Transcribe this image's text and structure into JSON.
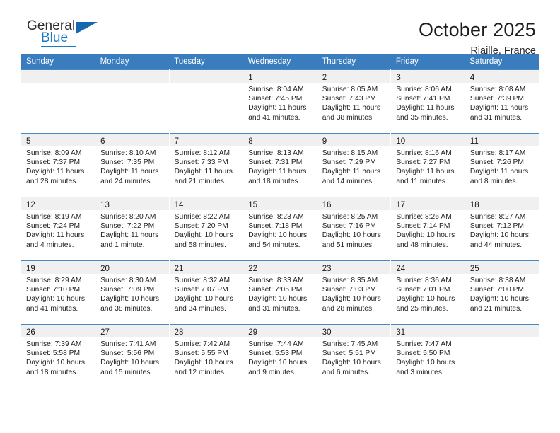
{
  "brand": {
    "name_top": "General",
    "name_bottom": "Blue",
    "accent_color": "#1b7ac4",
    "triangle_icon": "brand-triangle-icon"
  },
  "header": {
    "title": "October 2025",
    "subtitle": "Riaille, France"
  },
  "colors": {
    "header_row": "#3a7dbf",
    "row_divider": "#4a87c6",
    "daynum_band": "#f0f0f0"
  },
  "weekdays": [
    "Sunday",
    "Monday",
    "Tuesday",
    "Wednesday",
    "Thursday",
    "Friday",
    "Saturday"
  ],
  "labels": {
    "sunrise": "Sunrise:",
    "sunset": "Sunset:",
    "daylight": "Daylight:"
  },
  "weeks": [
    [
      {
        "day": "",
        "empty": true
      },
      {
        "day": "",
        "empty": true
      },
      {
        "day": "",
        "empty": true
      },
      {
        "day": "1",
        "sunrise": "Sunrise: 8:04 AM",
        "sunset": "Sunset: 7:45 PM",
        "daylight1": "Daylight: 11 hours",
        "daylight2": "and 41 minutes."
      },
      {
        "day": "2",
        "sunrise": "Sunrise: 8:05 AM",
        "sunset": "Sunset: 7:43 PM",
        "daylight1": "Daylight: 11 hours",
        "daylight2": "and 38 minutes."
      },
      {
        "day": "3",
        "sunrise": "Sunrise: 8:06 AM",
        "sunset": "Sunset: 7:41 PM",
        "daylight1": "Daylight: 11 hours",
        "daylight2": "and 35 minutes."
      },
      {
        "day": "4",
        "sunrise": "Sunrise: 8:08 AM",
        "sunset": "Sunset: 7:39 PM",
        "daylight1": "Daylight: 11 hours",
        "daylight2": "and 31 minutes."
      }
    ],
    [
      {
        "day": "5",
        "sunrise": "Sunrise: 8:09 AM",
        "sunset": "Sunset: 7:37 PM",
        "daylight1": "Daylight: 11 hours",
        "daylight2": "and 28 minutes."
      },
      {
        "day": "6",
        "sunrise": "Sunrise: 8:10 AM",
        "sunset": "Sunset: 7:35 PM",
        "daylight1": "Daylight: 11 hours",
        "daylight2": "and 24 minutes."
      },
      {
        "day": "7",
        "sunrise": "Sunrise: 8:12 AM",
        "sunset": "Sunset: 7:33 PM",
        "daylight1": "Daylight: 11 hours",
        "daylight2": "and 21 minutes."
      },
      {
        "day": "8",
        "sunrise": "Sunrise: 8:13 AM",
        "sunset": "Sunset: 7:31 PM",
        "daylight1": "Daylight: 11 hours",
        "daylight2": "and 18 minutes."
      },
      {
        "day": "9",
        "sunrise": "Sunrise: 8:15 AM",
        "sunset": "Sunset: 7:29 PM",
        "daylight1": "Daylight: 11 hours",
        "daylight2": "and 14 minutes."
      },
      {
        "day": "10",
        "sunrise": "Sunrise: 8:16 AM",
        "sunset": "Sunset: 7:27 PM",
        "daylight1": "Daylight: 11 hours",
        "daylight2": "and 11 minutes."
      },
      {
        "day": "11",
        "sunrise": "Sunrise: 8:17 AM",
        "sunset": "Sunset: 7:26 PM",
        "daylight1": "Daylight: 11 hours",
        "daylight2": "and 8 minutes."
      }
    ],
    [
      {
        "day": "12",
        "sunrise": "Sunrise: 8:19 AM",
        "sunset": "Sunset: 7:24 PM",
        "daylight1": "Daylight: 11 hours",
        "daylight2": "and 4 minutes."
      },
      {
        "day": "13",
        "sunrise": "Sunrise: 8:20 AM",
        "sunset": "Sunset: 7:22 PM",
        "daylight1": "Daylight: 11 hours",
        "daylight2": "and 1 minute."
      },
      {
        "day": "14",
        "sunrise": "Sunrise: 8:22 AM",
        "sunset": "Sunset: 7:20 PM",
        "daylight1": "Daylight: 10 hours",
        "daylight2": "and 58 minutes."
      },
      {
        "day": "15",
        "sunrise": "Sunrise: 8:23 AM",
        "sunset": "Sunset: 7:18 PM",
        "daylight1": "Daylight: 10 hours",
        "daylight2": "and 54 minutes."
      },
      {
        "day": "16",
        "sunrise": "Sunrise: 8:25 AM",
        "sunset": "Sunset: 7:16 PM",
        "daylight1": "Daylight: 10 hours",
        "daylight2": "and 51 minutes."
      },
      {
        "day": "17",
        "sunrise": "Sunrise: 8:26 AM",
        "sunset": "Sunset: 7:14 PM",
        "daylight1": "Daylight: 10 hours",
        "daylight2": "and 48 minutes."
      },
      {
        "day": "18",
        "sunrise": "Sunrise: 8:27 AM",
        "sunset": "Sunset: 7:12 PM",
        "daylight1": "Daylight: 10 hours",
        "daylight2": "and 44 minutes."
      }
    ],
    [
      {
        "day": "19",
        "sunrise": "Sunrise: 8:29 AM",
        "sunset": "Sunset: 7:10 PM",
        "daylight1": "Daylight: 10 hours",
        "daylight2": "and 41 minutes."
      },
      {
        "day": "20",
        "sunrise": "Sunrise: 8:30 AM",
        "sunset": "Sunset: 7:09 PM",
        "daylight1": "Daylight: 10 hours",
        "daylight2": "and 38 minutes."
      },
      {
        "day": "21",
        "sunrise": "Sunrise: 8:32 AM",
        "sunset": "Sunset: 7:07 PM",
        "daylight1": "Daylight: 10 hours",
        "daylight2": "and 34 minutes."
      },
      {
        "day": "22",
        "sunrise": "Sunrise: 8:33 AM",
        "sunset": "Sunset: 7:05 PM",
        "daylight1": "Daylight: 10 hours",
        "daylight2": "and 31 minutes."
      },
      {
        "day": "23",
        "sunrise": "Sunrise: 8:35 AM",
        "sunset": "Sunset: 7:03 PM",
        "daylight1": "Daylight: 10 hours",
        "daylight2": "and 28 minutes."
      },
      {
        "day": "24",
        "sunrise": "Sunrise: 8:36 AM",
        "sunset": "Sunset: 7:01 PM",
        "daylight1": "Daylight: 10 hours",
        "daylight2": "and 25 minutes."
      },
      {
        "day": "25",
        "sunrise": "Sunrise: 8:38 AM",
        "sunset": "Sunset: 7:00 PM",
        "daylight1": "Daylight: 10 hours",
        "daylight2": "and 21 minutes."
      }
    ],
    [
      {
        "day": "26",
        "sunrise": "Sunrise: 7:39 AM",
        "sunset": "Sunset: 5:58 PM",
        "daylight1": "Daylight: 10 hours",
        "daylight2": "and 18 minutes."
      },
      {
        "day": "27",
        "sunrise": "Sunrise: 7:41 AM",
        "sunset": "Sunset: 5:56 PM",
        "daylight1": "Daylight: 10 hours",
        "daylight2": "and 15 minutes."
      },
      {
        "day": "28",
        "sunrise": "Sunrise: 7:42 AM",
        "sunset": "Sunset: 5:55 PM",
        "daylight1": "Daylight: 10 hours",
        "daylight2": "and 12 minutes."
      },
      {
        "day": "29",
        "sunrise": "Sunrise: 7:44 AM",
        "sunset": "Sunset: 5:53 PM",
        "daylight1": "Daylight: 10 hours",
        "daylight2": "and 9 minutes."
      },
      {
        "day": "30",
        "sunrise": "Sunrise: 7:45 AM",
        "sunset": "Sunset: 5:51 PM",
        "daylight1": "Daylight: 10 hours",
        "daylight2": "and 6 minutes."
      },
      {
        "day": "31",
        "sunrise": "Sunrise: 7:47 AM",
        "sunset": "Sunset: 5:50 PM",
        "daylight1": "Daylight: 10 hours",
        "daylight2": "and 3 minutes."
      },
      {
        "day": "",
        "empty": true
      }
    ]
  ]
}
